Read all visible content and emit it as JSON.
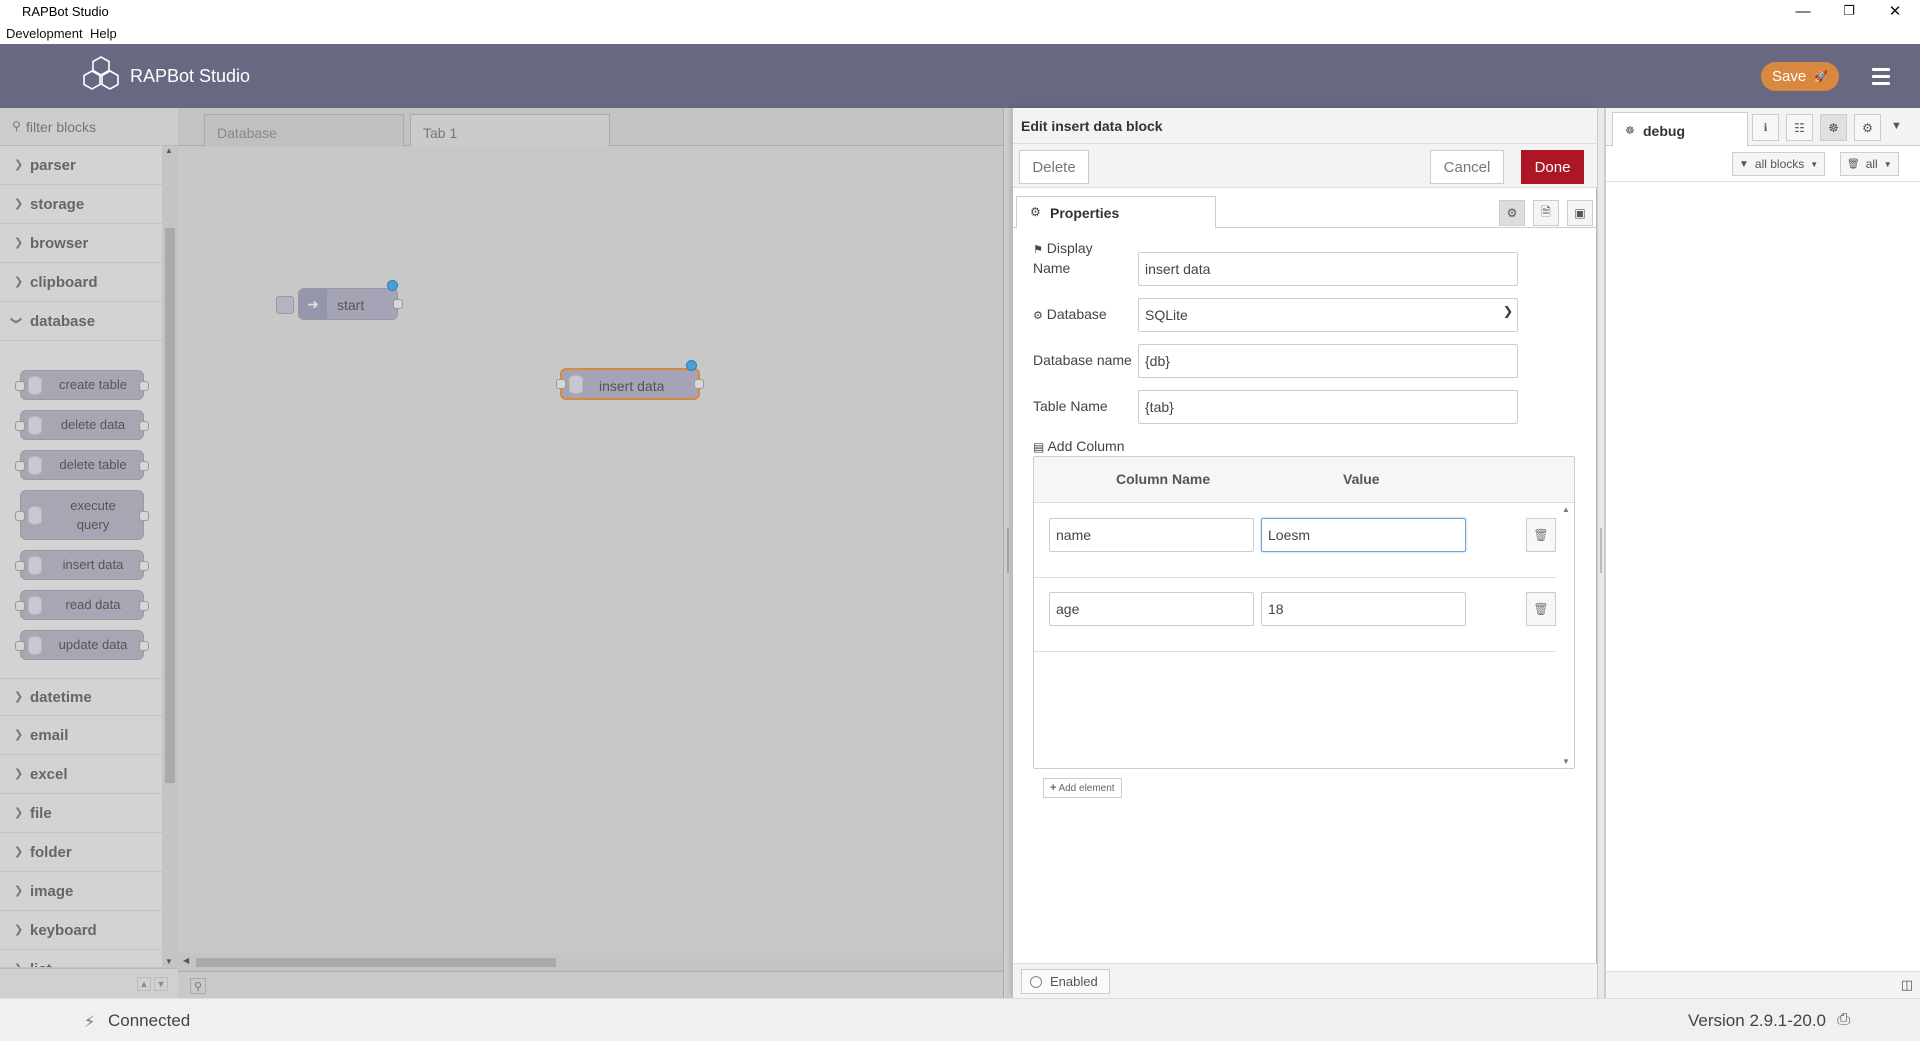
{
  "window": {
    "title": "RAPBot Studio",
    "minimize": "—",
    "restore": "❐",
    "close": "✕"
  },
  "menu": {
    "items": [
      "Development",
      "Help"
    ]
  },
  "header": {
    "brand": "RAPBot Studio",
    "save_label": "Save",
    "save_icon": "🚀"
  },
  "palette": {
    "filter_placeholder": "filter blocks",
    "categories_top": [
      "parser",
      "storage",
      "browser",
      "clipboard",
      "database"
    ],
    "database_nodes": [
      "create table",
      "delete data",
      "delete table",
      "execute query",
      "insert data",
      "read data",
      "update data"
    ],
    "categories_bottom": [
      "datetime",
      "email",
      "excel",
      "file",
      "folder",
      "image",
      "keyboard",
      "list"
    ]
  },
  "workspace": {
    "tabs": [
      "Database",
      "Tab 1"
    ],
    "active_tab": "Tab 1",
    "nodes": [
      {
        "label": "start",
        "icon": "arrow-right-icon"
      },
      {
        "label": "insert data",
        "icon": "database-icon"
      }
    ]
  },
  "editor": {
    "title": "Edit insert data block",
    "delete_label": "Delete",
    "cancel_label": "Cancel",
    "done_label": "Done",
    "tab_properties": "Properties",
    "display_name_label_1": "Display",
    "display_name_label_2": "Name",
    "display_name_value": "insert data",
    "database_label": "Database",
    "database_value": "SQLite",
    "database_name_label": "Database name",
    "database_name_value": "{db}",
    "table_name_label": "Table Name",
    "table_name_value": "{tab}",
    "add_column_label": "Add Column",
    "col_header_name": "Column Name",
    "col_header_value": "Value",
    "rows": [
      {
        "name": "name",
        "value": "Loesm"
      },
      {
        "name": "age",
        "value": "18"
      }
    ],
    "add_element_label": "Add element",
    "enabled_label": "Enabled"
  },
  "sidebar": {
    "tab": "debug",
    "filter_blocks": "all blocks",
    "filter_clear": "all"
  },
  "status": {
    "connection": "Connected",
    "version": "Version 2.9.1-20.0"
  },
  "colors": {
    "header": "#686882",
    "save": "#d8893f",
    "done": "#ad1625",
    "port_dot": "#4a9fd9"
  }
}
